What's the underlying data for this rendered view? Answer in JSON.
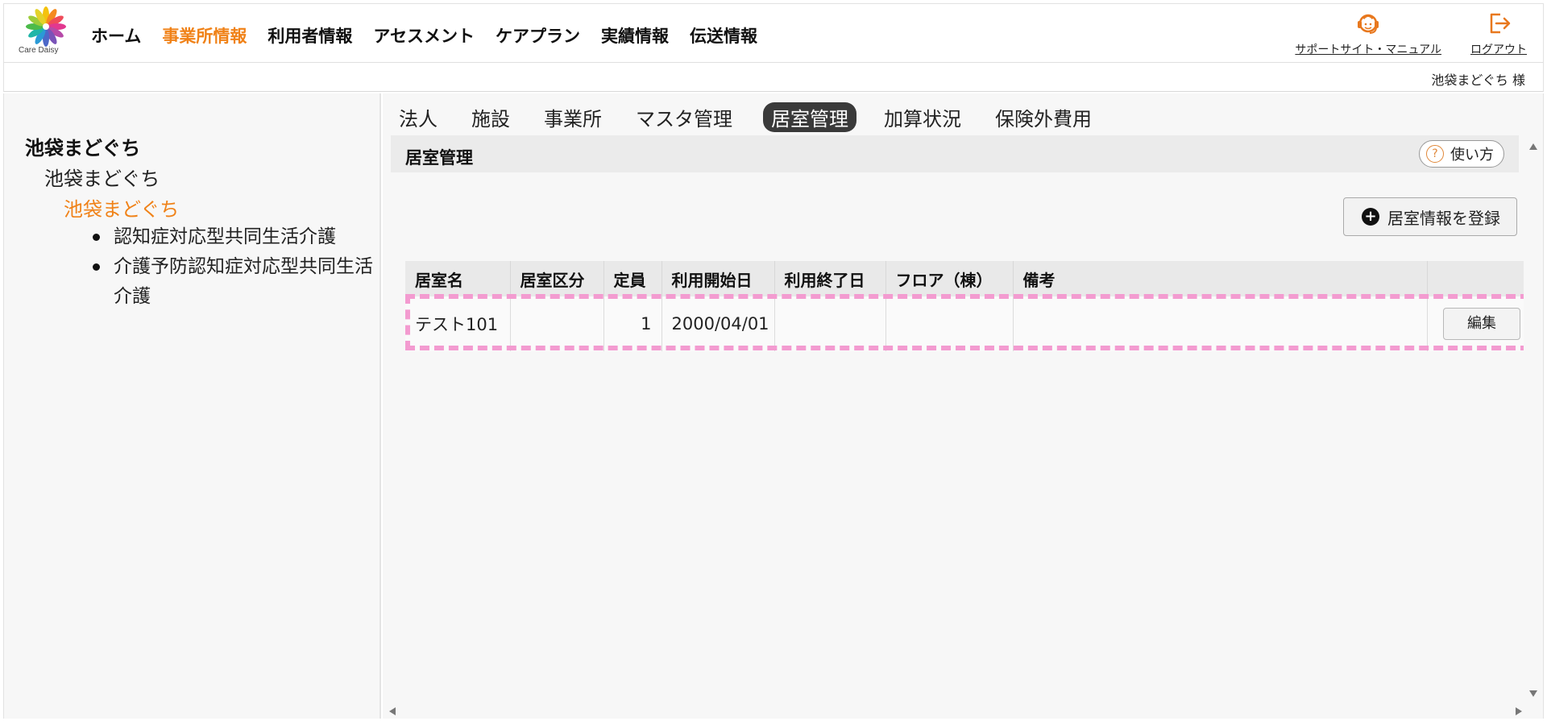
{
  "header": {
    "logo_text": "Care Daisy",
    "nav": [
      "ホーム",
      "事業所情報",
      "利用者情報",
      "アセスメント",
      "ケアプラン",
      "実績情報",
      "伝送情報"
    ],
    "nav_active_index": 1,
    "support_link": "サポートサイト・マニュアル",
    "logout_link": "ログアウト",
    "user_name": "池袋まどぐち 様",
    "accent_color": "#f08218"
  },
  "sidebar": {
    "root": "池袋まどぐち",
    "level2": "池袋まどぐち",
    "level3": "池袋まどぐち",
    "items": [
      "認知症対応型共同生活介護",
      "介護予防認知症対応型共同生活介護"
    ]
  },
  "subnav": {
    "items": [
      "法人",
      "施設",
      "事業所",
      "マスタ管理",
      "居室管理",
      "加算状況",
      "保険外費用"
    ],
    "active_index": 4
  },
  "section": {
    "title": "居室管理",
    "help_label": "使い方"
  },
  "register_button": "居室情報を登録",
  "table": {
    "headers": [
      "居室名",
      "居室区分",
      "定員",
      "利用開始日",
      "利用終了日",
      "フロア（棟）",
      "備考",
      ""
    ],
    "rows": [
      {
        "room_name": "テスト101",
        "room_type": "",
        "capacity": "1",
        "start_date": "2000/04/01",
        "end_date": "",
        "floor": "",
        "note": "",
        "edit_label": "編集"
      }
    ]
  }
}
